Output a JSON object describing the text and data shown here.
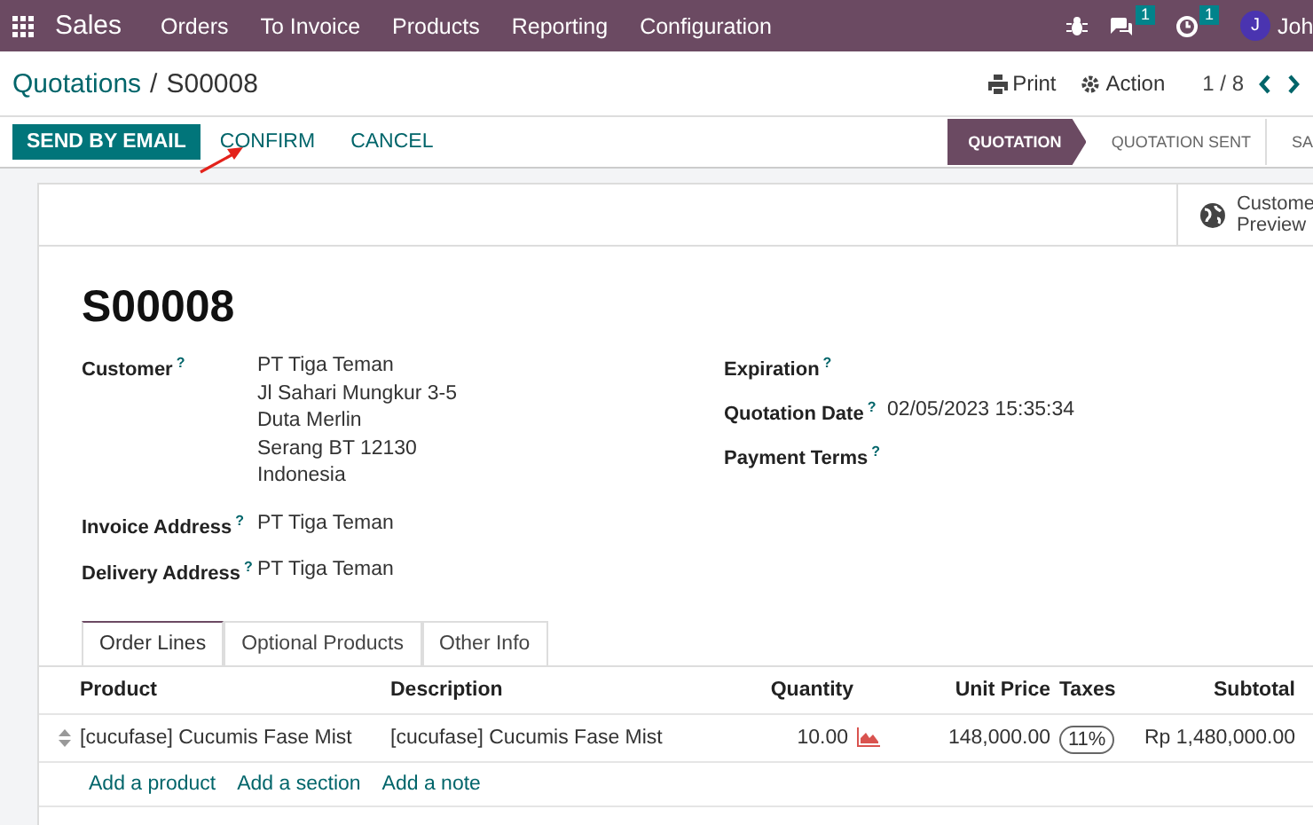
{
  "navbar": {
    "app": "Sales",
    "menu": [
      "Orders",
      "To Invoice",
      "Products",
      "Reporting",
      "Configuration"
    ],
    "chat_count": "1",
    "activity_count": "1",
    "user_initial": "J",
    "user_name": "Joh"
  },
  "breadcrumb": {
    "parent": "Quotations",
    "separator": "/",
    "current": "S00008"
  },
  "actions": {
    "print": "Print",
    "action": "Action",
    "pager": "1 / 8"
  },
  "buttons": [
    {
      "label": "SEND BY EMAIL",
      "kind": "primary"
    },
    {
      "label": "CONFIRM",
      "kind": "secondary"
    },
    {
      "label": "CANCEL",
      "kind": "secondary"
    }
  ],
  "stages": [
    {
      "label": "QUOTATION",
      "selected": true
    },
    {
      "label": "QUOTATION SENT",
      "selected": false
    },
    {
      "label": "SA",
      "selected": false
    }
  ],
  "smart_button": {
    "lines": [
      "Custome",
      "Preview"
    ]
  },
  "title": "S00008",
  "left_fields": [
    {
      "label": "Customer",
      "help": "?",
      "value": [
        "PT Tiga Teman",
        "Jl Sahari Mungkur 3-5",
        "Duta Merlin",
        "Serang BT 12130",
        "Indonesia"
      ]
    },
    {
      "label": "Invoice Address",
      "help": "?",
      "value": [
        "PT Tiga Teman"
      ]
    },
    {
      "label": "Delivery Address",
      "help": "?",
      "value": [
        "PT Tiga Teman"
      ]
    }
  ],
  "right_fields": [
    {
      "label": "Expiration",
      "help": "?"
    },
    {
      "label": "Quotation Date",
      "help": "?",
      "value": [
        "02/05/2023 15:35:34"
      ]
    },
    {
      "label": "Payment Terms",
      "help": "?"
    }
  ],
  "tabs": [
    {
      "label": "Order Lines",
      "selected": true
    },
    {
      "label": "Optional Products",
      "selected": false
    },
    {
      "label": "Other Info",
      "selected": false
    }
  ],
  "table": {
    "columns": [
      "Product",
      "Description",
      "Quantity",
      "Unit Price",
      "Taxes",
      "Subtotal"
    ],
    "rows": [
      {
        "product": "[cucufase] Cucumis Fase Mist",
        "description": "[cucufase] Cucumis Fase Mist",
        "quantity": "10.00",
        "unit_price": "148,000.00",
        "taxes": "11%",
        "subtotal": "Rp 1,480,000.00"
      }
    ]
  },
  "add_links": [
    "Add a product",
    "Add a section",
    "Add a note"
  ]
}
